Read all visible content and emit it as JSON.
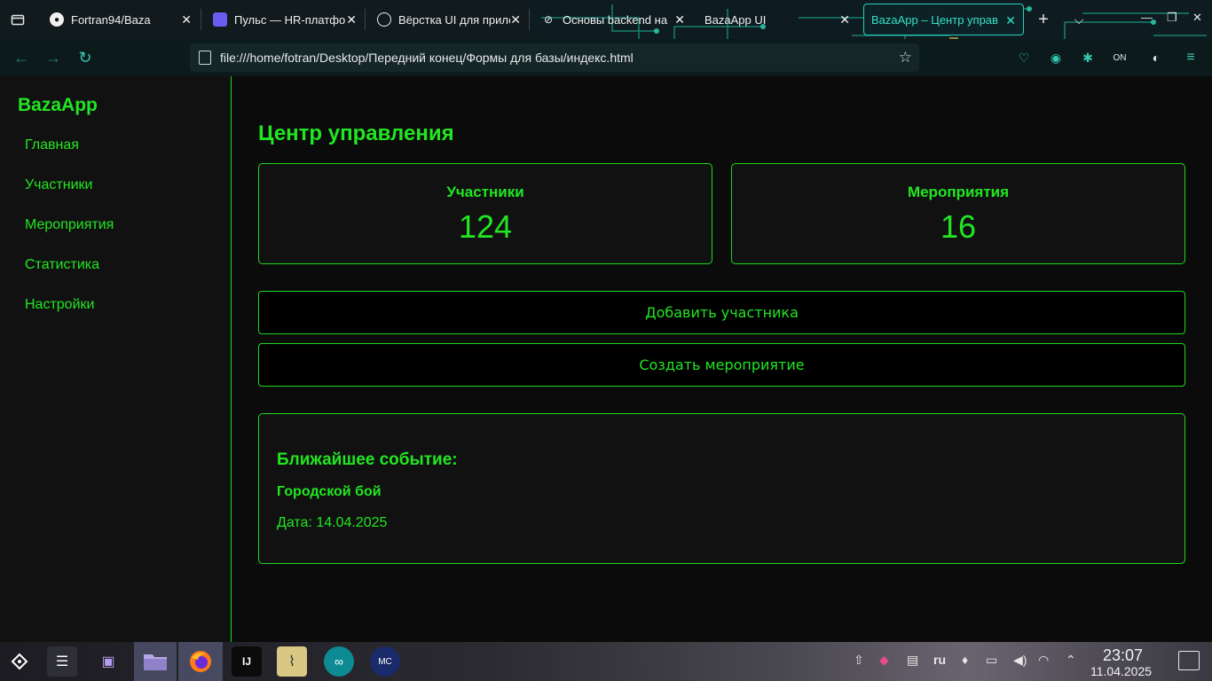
{
  "browser": {
    "tabs": [
      {
        "title": "Fortran94/Baza",
        "icon": "github-icon"
      },
      {
        "title": "Пульс — HR-платформа",
        "icon": "puls-icon"
      },
      {
        "title": "Вёрстка UI для прило",
        "icon": "openai-icon"
      },
      {
        "title": "Основы backend на",
        "icon": "link-icon"
      },
      {
        "title": "BazaApp UI",
        "icon": "none"
      },
      {
        "title": "BazaApp – Центр управ",
        "icon": "none",
        "active": true
      }
    ],
    "url": "file:///home/fotran/Desktop/Передний конец/Формы для базы/индекс.html",
    "accent": "#35c9b2"
  },
  "sidebar": {
    "brand": "BazaApp",
    "items": [
      {
        "label": "Главная"
      },
      {
        "label": "Участники"
      },
      {
        "label": "Мероприятия"
      },
      {
        "label": "Статистика"
      },
      {
        "label": "Настройки"
      }
    ]
  },
  "main": {
    "title": "Центр управления",
    "stats": [
      {
        "label": "Участники",
        "value": "124"
      },
      {
        "label": "Мероприятия",
        "value": "16"
      }
    ],
    "actions": [
      {
        "label": "Добавить участника"
      },
      {
        "label": "Создать мероприятие"
      }
    ],
    "event": {
      "heading": "Ближайшее событие:",
      "name": "Городской бой",
      "date": "Дата: 14.04.2025"
    }
  },
  "theme": {
    "accent": "#22e622",
    "background": "#0b0b0b",
    "panel": "#111111"
  },
  "taskbar": {
    "keyboard_layout": "ru",
    "time": "23:07",
    "date": "11.04.2025"
  }
}
